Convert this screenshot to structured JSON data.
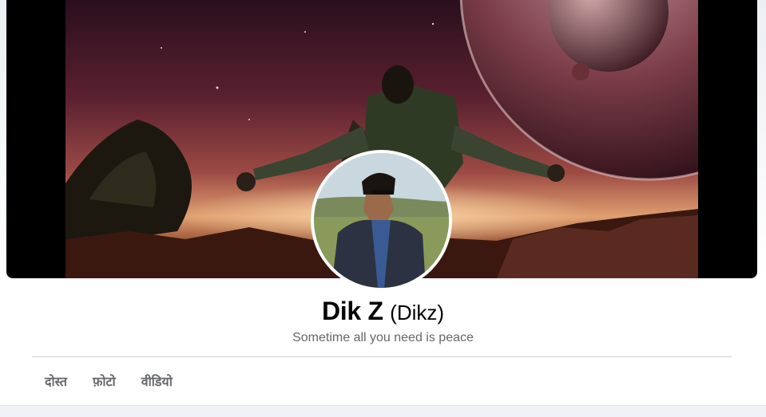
{
  "profile": {
    "name": "Dik Z",
    "alternate_name": "(Dikz)",
    "bio": "Sometime all you need is peace"
  },
  "tabs": [
    {
      "label": "दोस्त"
    },
    {
      "label": "फ़ोटो"
    },
    {
      "label": "वीडियो"
    }
  ],
  "colors": {
    "page_background": "#ffffff",
    "name_text": "#050505",
    "secondary_text": "#65676b",
    "divider": "#ced0d4",
    "footer_background": "#f0f2f5"
  }
}
